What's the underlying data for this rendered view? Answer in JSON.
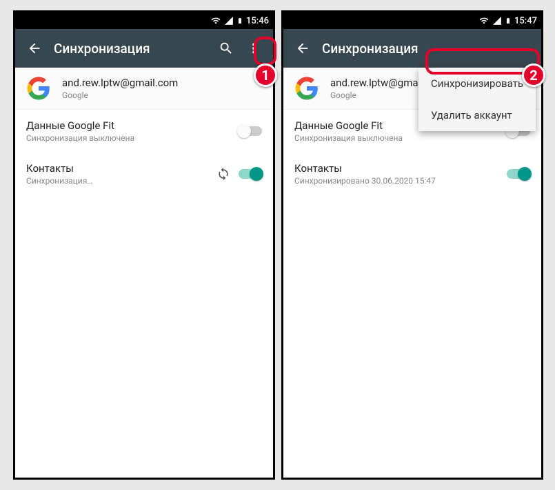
{
  "left": {
    "status_time": "15:46",
    "appbar_title": "Синхронизация",
    "account_email": "and.rew.lptw@gmail.com",
    "account_provider": "Google",
    "items": [
      {
        "title": "Данные Google Fit",
        "sub": "Синхронизация выключена",
        "on": false,
        "syncing": false
      },
      {
        "title": "Контакты",
        "sub": "Синхронизация…",
        "on": true,
        "syncing": true
      }
    ],
    "badge": "1"
  },
  "right": {
    "status_time": "15:47",
    "appbar_title": "Синхронизация",
    "account_email": "and.rew.lptw@gmail.com",
    "account_provider": "Google",
    "items": [
      {
        "title": "Данные Google Fit",
        "sub": "Синхронизация выключена",
        "on": false,
        "syncing": false
      },
      {
        "title": "Контакты",
        "sub": "Синхронизировано 30.06.2020 15:47",
        "on": true,
        "syncing": false
      }
    ],
    "menu": {
      "sync": "Синхронизировать",
      "delete": "Удалить аккаунт"
    },
    "badge": "2"
  }
}
